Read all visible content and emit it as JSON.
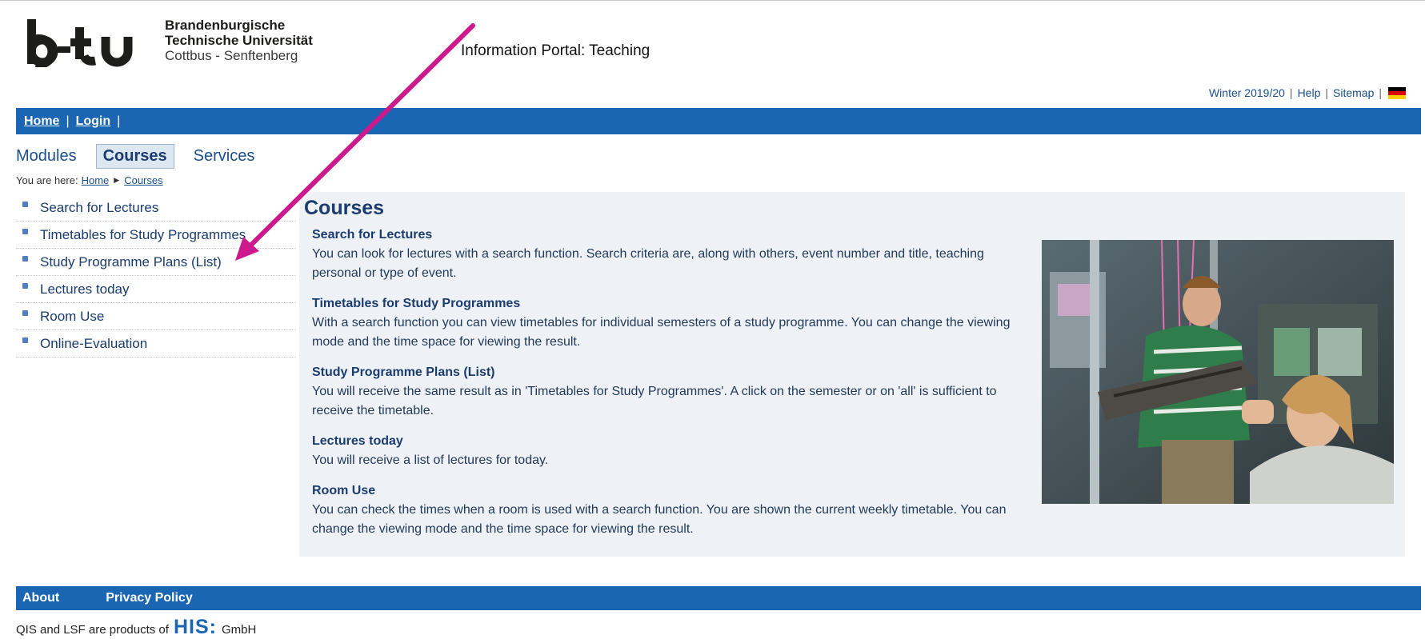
{
  "header": {
    "logo_word": "b-tu",
    "logo_lines": [
      "Brandenburgische",
      "Technische Universität",
      "Cottbus - Senftenberg"
    ],
    "portal_title": "Information Portal: Teaching"
  },
  "top_links": {
    "semester": "Winter 2019/20",
    "help": "Help",
    "sitemap": "Sitemap",
    "language_icon": "german-flag-icon"
  },
  "navbar": {
    "home": "Home",
    "login": "Login"
  },
  "tabs": [
    {
      "label": "Modules",
      "active": false
    },
    {
      "label": "Courses",
      "active": true
    },
    {
      "label": "Services",
      "active": false
    }
  ],
  "breadcrumb": {
    "prefix": "You are here:",
    "items": [
      "Home",
      "Courses"
    ]
  },
  "left_menu": [
    "Search for Lectures",
    "Timetables for Study Programmes",
    "Study Programme Plans (List)",
    "Lectures today",
    "Room Use",
    "Online-Evaluation"
  ],
  "content": {
    "title": "Courses",
    "sections": [
      {
        "head": "Search for Lectures",
        "body": "You can look for lectures with a search function. Search criteria are, along with others, event number and title, teaching personal or type of event."
      },
      {
        "head": "Timetables for Study Programmes",
        "body": "With a search function you can view timetables for individual semesters of a study programme. You can change the viewing mode and the time space for viewing the result."
      },
      {
        "head": "Study Programme Plans (List)",
        "body": "You will receive the same result as in 'Timetables for Study Programmes'. A click on the semester or on 'all' is sufficient to receive the timetable."
      },
      {
        "head": "Lectures today",
        "body": "You will receive a list of lectures for today."
      },
      {
        "head": "Room Use",
        "body": "You can check the times when a room is used with a search function. You are shown the current weekly timetable. You can change the viewing mode and the time space for viewing the result."
      }
    ]
  },
  "footer": {
    "links": [
      "About",
      "Privacy Policy"
    ],
    "credits_prefix": "QIS and LSF are products of",
    "his_logo": "HIS:",
    "credits_suffix": "GmbH"
  },
  "colors": {
    "brand_blue": "#1b66b3",
    "link_blue": "#1a4f8c",
    "annotation_arrow": "#cc1a8c",
    "panel_bg": "#eef2f6"
  }
}
